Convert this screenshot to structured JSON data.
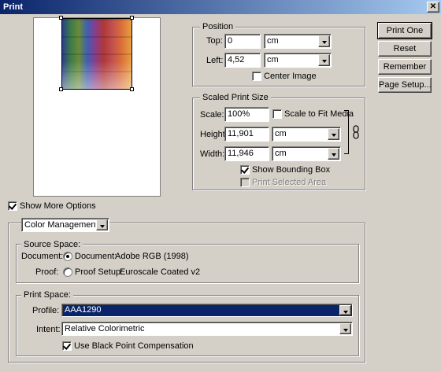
{
  "window": {
    "title": "Print"
  },
  "buttons": {
    "print_one": "Print One",
    "reset": "Reset",
    "remember": "Remember",
    "page_setup": "Page Setup..."
  },
  "position": {
    "legend": "Position",
    "top_label": "Top:",
    "top_value": "0",
    "top_unit": "cm",
    "left_label": "Left:",
    "left_value": "4,52",
    "left_unit": "cm",
    "center_image_label": "Center Image",
    "center_image_checked": false
  },
  "scaled_print_size": {
    "legend": "Scaled Print Size",
    "scale_label": "Scale:",
    "scale_value": "100%",
    "scale_to_fit_label": "Scale to Fit Media",
    "scale_to_fit_checked": false,
    "height_label": "Height:",
    "height_value": "11,901",
    "height_unit": "cm",
    "width_label": "Width:",
    "width_value": "11,946",
    "width_unit": "cm",
    "show_bounding_box_label": "Show Bounding Box",
    "show_bounding_box_checked": true,
    "print_selected_area_label": "Print Selected Area",
    "print_selected_area_checked": false
  },
  "show_more_options": {
    "label": "Show More Options",
    "checked": true
  },
  "more_options": {
    "section_select": "Color Management",
    "source_space": {
      "legend": "Source Space:",
      "document_row_label": "Document:",
      "document_radio_label": "Document:",
      "document_value": "Adobe RGB (1998)",
      "proof_row_label": "Proof:",
      "proof_radio_label": "Proof Setup:",
      "proof_value": "Euroscale Coated v2"
    },
    "print_space": {
      "legend": "Print Space:",
      "profile_label": "Profile:",
      "profile_value": "AAA1290",
      "intent_label": "Intent:",
      "intent_value": "Relative Colorimetric",
      "black_point_label": "Use Black Point Compensation",
      "black_point_checked": true
    }
  },
  "icons": {
    "close": "close-icon",
    "link": "link-chain-icon",
    "dropdown": "chevron-down-icon"
  }
}
